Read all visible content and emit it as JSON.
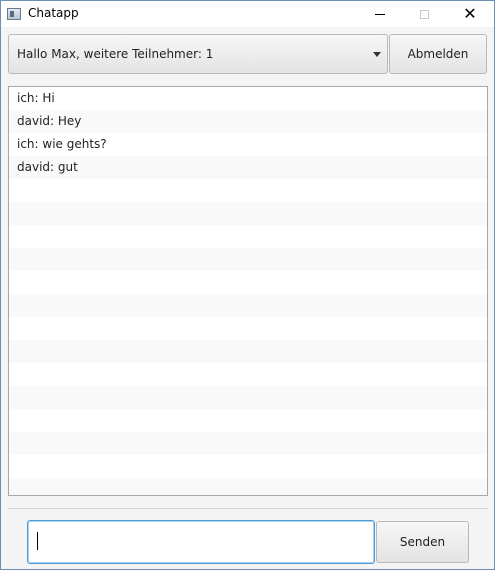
{
  "window": {
    "title": "Chatapp",
    "icon": "app-window-icon",
    "controls": {
      "minimize_icon": "minimize-icon",
      "maximize_icon": "maximize-icon",
      "close_icon": "close-icon",
      "close_glyph": "✕"
    }
  },
  "header": {
    "user_select": {
      "selected": "Hallo Max, weitere Teilnehmer: 1",
      "arrow_icon": "chevron-down-icon"
    },
    "logout_label": "Abmelden"
  },
  "messages": [
    {
      "text": " ich: Hi"
    },
    {
      "text": "david: Hey"
    },
    {
      "text": " ich: wie gehts?"
    },
    {
      "text": "david: gut"
    },
    {
      "text": ""
    },
    {
      "text": ""
    },
    {
      "text": ""
    },
    {
      "text": ""
    },
    {
      "text": ""
    },
    {
      "text": ""
    },
    {
      "text": ""
    },
    {
      "text": ""
    },
    {
      "text": ""
    },
    {
      "text": ""
    },
    {
      "text": ""
    },
    {
      "text": ""
    },
    {
      "text": ""
    },
    {
      "text": ""
    }
  ],
  "composer": {
    "input_value": "",
    "send_label": "Senden"
  },
  "colors": {
    "accent_focus": "#4d9cd6",
    "row_alt": "#f9f9f9"
  }
}
